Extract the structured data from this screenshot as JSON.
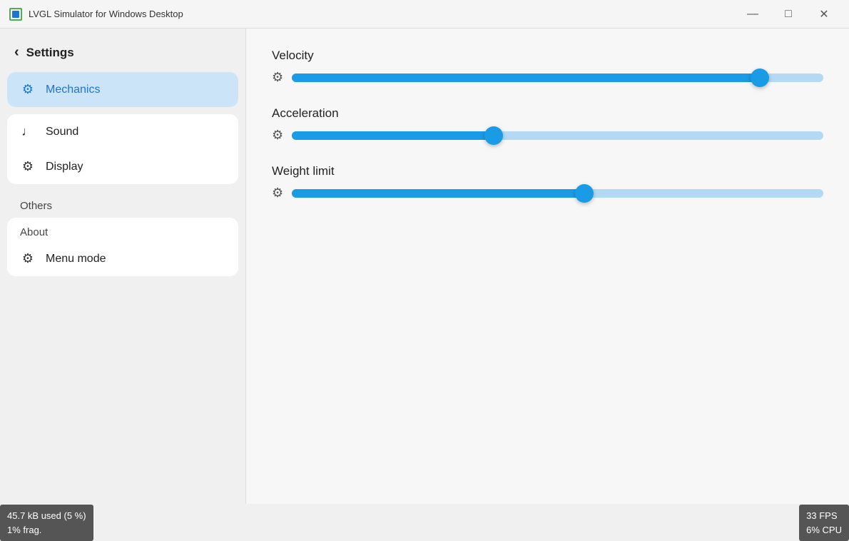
{
  "window": {
    "title": "LVGL Simulator for Windows Desktop",
    "controls": {
      "minimize": "—",
      "maximize": "□",
      "close": "✕"
    }
  },
  "sidebar": {
    "back_label": "Settings",
    "groups": [
      {
        "items": [
          {
            "id": "mechanics",
            "label": "Mechanics",
            "icon": "⚙",
            "active": true
          }
        ]
      },
      {
        "items": [
          {
            "id": "sound",
            "label": "Sound",
            "icon": "♩",
            "active": false
          },
          {
            "id": "display",
            "label": "Display",
            "icon": "⚙",
            "active": false
          }
        ]
      }
    ],
    "others_label": "Others",
    "about_group": {
      "label": "About",
      "items": [
        {
          "id": "menu-mode",
          "label": "Menu mode",
          "icon": "⚙",
          "active": false
        }
      ]
    }
  },
  "content": {
    "sliders": [
      {
        "id": "velocity",
        "label": "Velocity",
        "value_percent": 88
      },
      {
        "id": "acceleration",
        "label": "Acceleration",
        "value_percent": 38
      },
      {
        "id": "weight-limit",
        "label": "Weight limit",
        "value_percent": 55
      }
    ]
  },
  "status_bar": {
    "left_line1": "45.7 kB used (5 %)",
    "left_line2": "1% frag.",
    "right_line1": "33 FPS",
    "right_line2": "6% CPU"
  }
}
